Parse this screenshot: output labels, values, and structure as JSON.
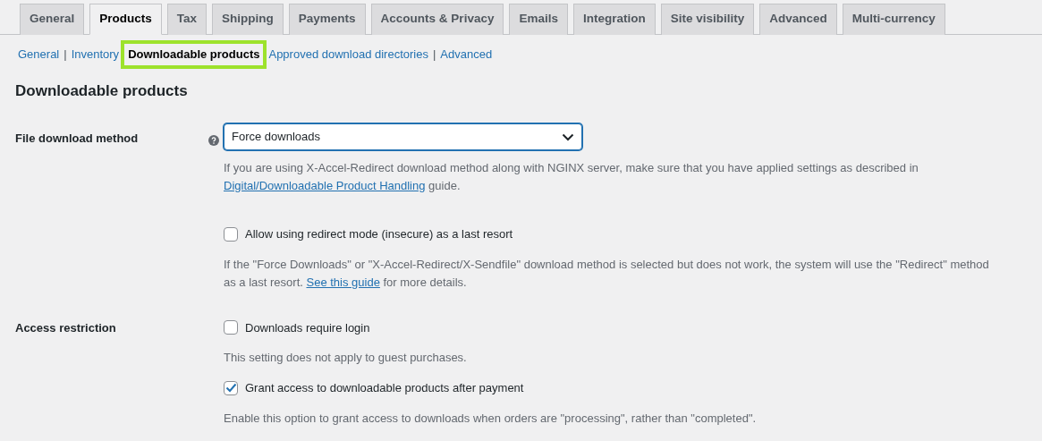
{
  "tabs": [
    {
      "label": "General",
      "selected": false
    },
    {
      "label": "Products",
      "selected": true
    },
    {
      "label": "Tax",
      "selected": false
    },
    {
      "label": "Shipping",
      "selected": false
    },
    {
      "label": "Payments",
      "selected": false
    },
    {
      "label": "Accounts & Privacy",
      "selected": false
    },
    {
      "label": "Emails",
      "selected": false
    },
    {
      "label": "Integration",
      "selected": false
    },
    {
      "label": "Site visibility",
      "selected": false
    },
    {
      "label": "Advanced",
      "selected": false
    },
    {
      "label": "Multi-currency",
      "selected": false
    }
  ],
  "subnav": [
    {
      "kind": "link",
      "label": "General",
      "selected": false
    },
    {
      "kind": "separator",
      "label": "|"
    },
    {
      "kind": "link",
      "label": "Inventory",
      "selected": false
    },
    {
      "kind": "link",
      "label": "Downloadable products",
      "selected": true
    },
    {
      "kind": "link",
      "label": "Approved download directories",
      "selected": false
    },
    {
      "kind": "separator",
      "label": "|"
    },
    {
      "kind": "link",
      "label": "Advanced",
      "selected": false
    }
  ],
  "section_title": "Downloadable products",
  "settings": [
    {
      "label": "File download method",
      "help": true,
      "items": [
        {
          "kind": "select",
          "value": "Force downloads"
        },
        {
          "kind": "description",
          "parts": [
            {
              "kind": "text",
              "text": "If you are using X-Accel-Redirect download method along with NGINX server, make sure that you have applied settings as described in "
            },
            {
              "kind": "link",
              "text": "Digital/Downloadable Product Handling"
            },
            {
              "kind": "text",
              "text": " guide."
            }
          ]
        },
        {
          "kind": "checkbox",
          "label": "Allow using redirect mode (insecure) as a last resort",
          "checked": false
        },
        {
          "kind": "description",
          "parts": [
            {
              "kind": "text",
              "text": "If the \"Force Downloads\" or \"X-Accel-Redirect/X-Sendfile\" download method is selected but does not work, the system will use the \"Redirect\" method as a last resort. "
            },
            {
              "kind": "link",
              "text": "See this guide"
            },
            {
              "kind": "text",
              "text": " for more details."
            }
          ]
        }
      ]
    },
    {
      "label": "Access restriction",
      "help": false,
      "items": [
        {
          "kind": "checkbox",
          "label": "Downloads require login",
          "checked": false
        },
        {
          "kind": "description",
          "parts": [
            {
              "kind": "text",
              "text": "This setting does not apply to guest purchases."
            }
          ]
        },
        {
          "kind": "checkbox",
          "label": "Grant access to downloadable products after payment",
          "checked": true
        },
        {
          "kind": "description",
          "parts": [
            {
              "kind": "text",
              "text": "Enable this option to grant access to downloads when orders are \"processing\", rather than \"completed\"."
            }
          ]
        }
      ]
    }
  ]
}
